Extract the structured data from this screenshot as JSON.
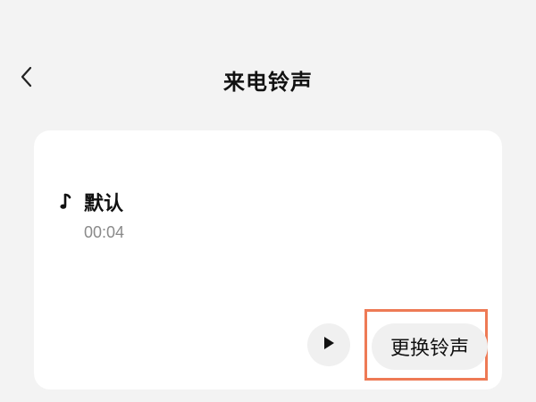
{
  "header": {
    "title": "来电铃声",
    "back_icon": "chevron-left-icon"
  },
  "ringtone": {
    "icon": "music-note-icon",
    "name": "默认",
    "duration": "00:04"
  },
  "actions": {
    "play_icon": "play-icon",
    "change_label": "更换铃声"
  },
  "colors": {
    "background": "#f3f3f3",
    "card": "#ffffff",
    "button_bg": "#f0f0f0",
    "highlight": "#ee7a55",
    "secondary_text": "#8a8a8a"
  }
}
